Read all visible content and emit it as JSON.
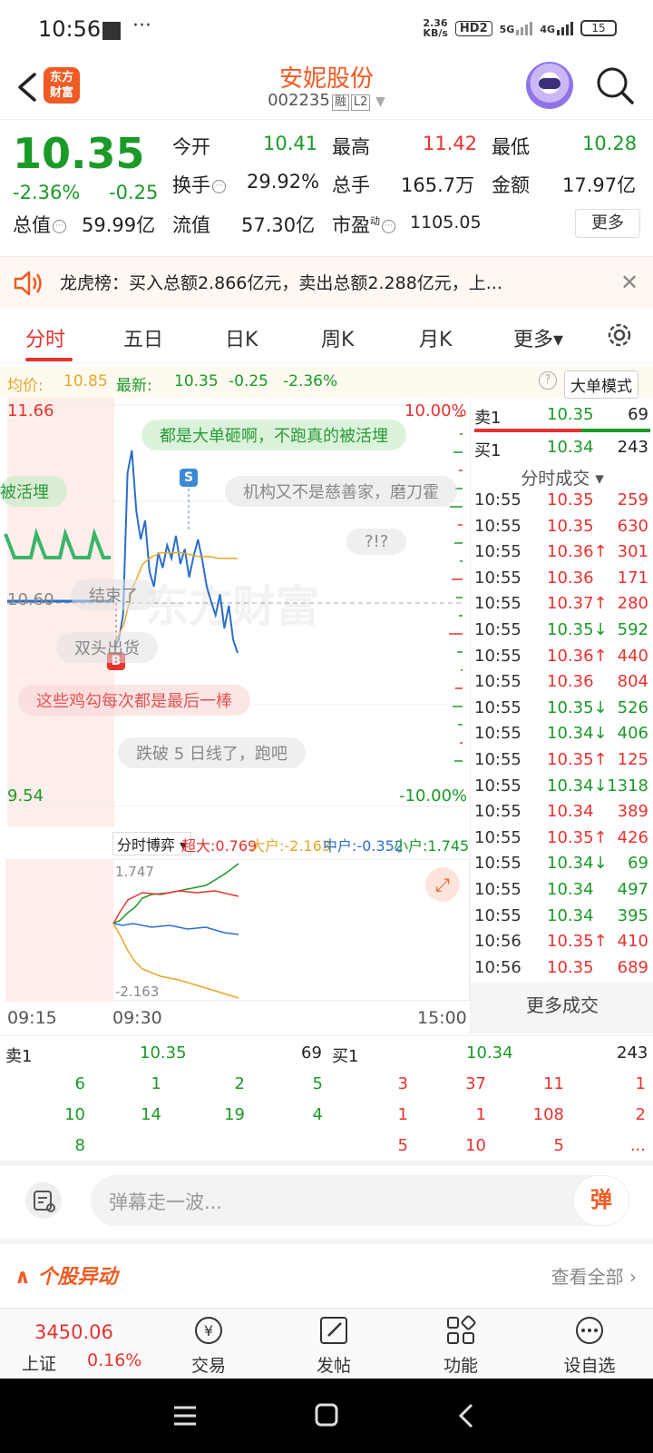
{
  "status_bar": {
    "time": "10:56",
    "dots": "···",
    "net_speed": "2.36\nKB/s",
    "hd": "HD2",
    "sig1": "5G",
    "sig2": "4G",
    "battery": "15"
  },
  "header": {
    "logo_text": "东方\n财富",
    "stock_name": "安妮股份",
    "stock_code": "002235",
    "tag_margin": "融",
    "tag_level": "L2"
  },
  "quote": {
    "price": "10.35",
    "change_pct": "-2.36%",
    "change_amt": "-0.25",
    "open_label": "今开",
    "open": "10.41",
    "high_label": "最高",
    "high": "11.42",
    "low_label": "最低",
    "low": "10.28",
    "turnover_label": "换手",
    "turnover": "29.92%",
    "volume_label": "总手",
    "volume": "165.7万",
    "amount_label": "金额",
    "amount": "17.97亿",
    "mktcap_label": "总值",
    "mktcap": "59.99亿",
    "float_label": "流值",
    "float": "57.30亿",
    "pe_label": "市盈",
    "pe_sup": "动",
    "pe": "1105.05",
    "more": "更多"
  },
  "notice": {
    "text": "龙虎榜：买入总额2.866亿元，卖出总额2.288亿元，上..."
  },
  "tabs": [
    "分时",
    "五日",
    "日K",
    "周K",
    "月K",
    "更多▾"
  ],
  "avg_row": {
    "avg_label": "均价:",
    "avg": "10.85",
    "latest_label": "最新:",
    "latest": "10.35",
    "chg": "-0.25",
    "pct": "-2.36%",
    "big_mode": "大单模式"
  },
  "chart": {
    "top_price": "11.66",
    "bottom_price": "9.54",
    "mid_price": "10.60",
    "top_pct": "10.00%",
    "bottom_pct": "-10.00%",
    "marker_s": "S",
    "marker_b": "B",
    "barrages": [
      "都是大单砸啊，不跑真的被活埋",
      "被活埋",
      "机构又不是慈善家，磨刀霍",
      "?!?",
      "结束了",
      "双头出货",
      "这些鸡勾每次都是最后一棒",
      "跌破 5 日线了，跑吧"
    ],
    "watermark": "东方财富"
  },
  "chart_data": {
    "type": "line",
    "title": "",
    "xlabel": "",
    "ylabel": "",
    "ylim": [
      9.54,
      11.66
    ],
    "x_ticks": [
      "09:15",
      "09:30",
      "15:00"
    ],
    "series": [
      {
        "name": "",
        "color": "#2a6fc9",
        "values": [
          10.38,
          10.42,
          10.55,
          11.3,
          11.42,
          11.1,
          10.95,
          11.05,
          10.78,
          10.7,
          10.88,
          10.8,
          10.92,
          10.85,
          10.97,
          10.82,
          10.9,
          10.75,
          10.86,
          10.95,
          10.84,
          10.7,
          10.62,
          10.55,
          10.66,
          10.48,
          10.6,
          10.42,
          10.35
        ]
      },
      {
        "name": "",
        "color": "#e8a628",
        "values": [
          10.4,
          10.5,
          10.7,
          10.82,
          10.86,
          10.88,
          10.88,
          10.88,
          10.87,
          10.86,
          10.86,
          10.85,
          10.85,
          10.85
        ]
      }
    ],
    "prev_close": 10.6
  },
  "game": {
    "label": "分时博弈",
    "super_label": "超大:",
    "super": "0.769",
    "big_label": "大户:",
    "big": "-2.163",
    "mid_label": "中户:",
    "mid": "-0.352",
    "small_label": "小户:",
    "small": "1.745",
    "max": "1.747",
    "min": "-2.163"
  },
  "times": {
    "t1": "09:15",
    "t2": "09:30",
    "t3": "15:00"
  },
  "book": {
    "sell1_label": "卖1",
    "sell1_price": "10.35",
    "sell1_vol": "69",
    "buy1_label": "买1",
    "buy1_price": "10.34",
    "buy1_vol": "243",
    "trades_title": "分时成交 ▾",
    "trades": [
      {
        "t": "10:55",
        "p": "10.35",
        "v": "259",
        "c": "red",
        "a": ""
      },
      {
        "t": "10:55",
        "p": "10.35",
        "v": "630",
        "c": "red",
        "a": ""
      },
      {
        "t": "10:55",
        "p": "10.36",
        "v": "301",
        "c": "red",
        "a": "↑"
      },
      {
        "t": "10:55",
        "p": "10.36",
        "v": "171",
        "c": "red",
        "a": ""
      },
      {
        "t": "10:55",
        "p": "10.37",
        "v": "280",
        "c": "red",
        "a": "↑"
      },
      {
        "t": "10:55",
        "p": "10.35",
        "v": "592",
        "c": "green",
        "a": "↓"
      },
      {
        "t": "10:55",
        "p": "10.36",
        "v": "440",
        "c": "red",
        "a": "↑"
      },
      {
        "t": "10:55",
        "p": "10.36",
        "v": "804",
        "c": "red",
        "a": ""
      },
      {
        "t": "10:55",
        "p": "10.35",
        "v": "526",
        "c": "green",
        "a": "↓"
      },
      {
        "t": "10:55",
        "p": "10.34",
        "v": "406",
        "c": "green",
        "a": "↓"
      },
      {
        "t": "10:55",
        "p": "10.35",
        "v": "125",
        "c": "red",
        "a": "↑"
      },
      {
        "t": "10:55",
        "p": "10.34",
        "v": "1318",
        "c": "green",
        "a": "↓"
      },
      {
        "t": "10:55",
        "p": "10.34",
        "v": "389",
        "c": "red",
        "a": ""
      },
      {
        "t": "10:55",
        "p": "10.35",
        "v": "426",
        "c": "red",
        "a": "↑"
      },
      {
        "t": "10:55",
        "p": "10.34",
        "v": "69",
        "c": "green",
        "a": "↓"
      },
      {
        "t": "10:55",
        "p": "10.34",
        "v": "497",
        "c": "green",
        "a": ""
      },
      {
        "t": "10:55",
        "p": "10.34",
        "v": "395",
        "c": "green",
        "a": ""
      },
      {
        "t": "10:56",
        "p": "10.35",
        "v": "410",
        "c": "red",
        "a": "↑"
      },
      {
        "t": "10:56",
        "p": "10.35",
        "v": "689",
        "c": "red",
        "a": ""
      }
    ],
    "more_trades": "更多成交"
  },
  "orderbook": {
    "sell_label": "卖1",
    "sell_price": "10.35",
    "sell_vol": "69",
    "buy_label": "买1",
    "buy_price": "10.34",
    "buy_vol": "243",
    "sell_queue": [
      [
        "6",
        "1",
        "2",
        "5"
      ],
      [
        "10",
        "14",
        "19",
        "4"
      ],
      [
        "8",
        "",
        "",
        ""
      ]
    ],
    "buy_queue": [
      [
        "3",
        "37",
        "11",
        "1"
      ],
      [
        "1",
        "1",
        "108",
        "2"
      ],
      [
        "5",
        "10",
        "5",
        "..."
      ]
    ]
  },
  "danmu": {
    "placeholder": "弹幕走一波...",
    "btn": "弹"
  },
  "abnormal": {
    "title": "个股异动",
    "view_all": "查看全部"
  },
  "nav": {
    "index_value": "3450.06",
    "index_name": "上证",
    "index_pct": "0.16%",
    "items": [
      "交易",
      "发帖",
      "功能",
      "设自选"
    ]
  },
  "colors": {
    "accent": "#f05a23",
    "up": "#e8322e",
    "down": "#1a9a27",
    "price_line": "#2a6fc9",
    "avg_line": "#e8a628"
  }
}
